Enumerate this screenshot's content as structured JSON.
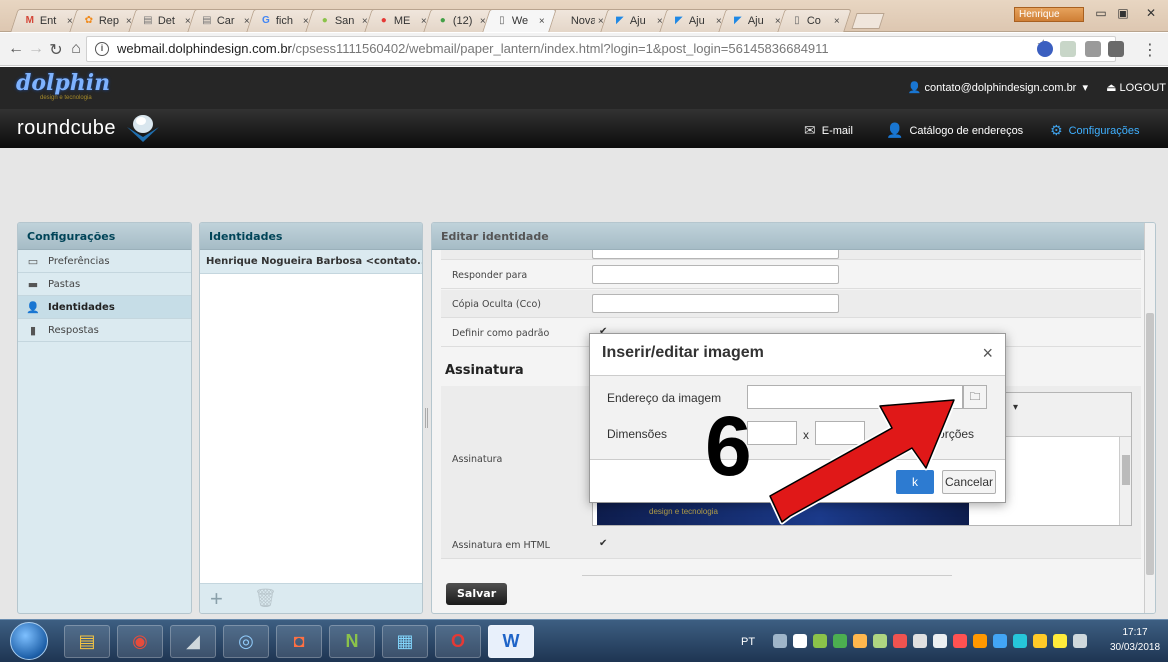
{
  "browser": {
    "tabs": [
      {
        "icon_text": "M",
        "icon_color": "#d44638",
        "title": "Ent"
      },
      {
        "icon_text": "✿",
        "icon_color": "#f08a1c",
        "title": "Rep"
      },
      {
        "icon_text": "▤",
        "icon_color": "#777777",
        "title": "Det"
      },
      {
        "icon_text": "▤",
        "icon_color": "#777777",
        "title": "Car"
      },
      {
        "icon_text": "G",
        "icon_color": "#4285f4",
        "title": "fich"
      },
      {
        "icon_text": "●",
        "icon_color": "#8bc34a",
        "title": "San"
      },
      {
        "icon_text": "●",
        "icon_color": "#e53935",
        "title": "ME"
      },
      {
        "icon_text": "●",
        "icon_color": "#43a047",
        "title": "(12)"
      },
      {
        "icon_text": "▯",
        "icon_color": "#666666",
        "title": "We"
      },
      {
        "icon_text": "",
        "icon_color": "#666666",
        "title": "Nova g"
      },
      {
        "icon_text": "◤",
        "icon_color": "#1e88e5",
        "title": "Aju"
      },
      {
        "icon_text": "◤",
        "icon_color": "#1e88e5",
        "title": "Aju"
      },
      {
        "icon_text": "◤",
        "icon_color": "#1e88e5",
        "title": "Aju"
      },
      {
        "icon_text": "▯",
        "icon_color": "#666666",
        "title": "Co"
      }
    ],
    "close_glyph": "×",
    "active_tab_index": 8,
    "window_user": "Henrique",
    "url_host": "webmail.dolphindesign.com.br",
    "url_path": "/cpsess1111560402/webmail/paper_lantern/index.html?login=1&post_login=56145836684911"
  },
  "dolphin": {
    "logo_text": "dolphin",
    "logo_sub": "design e tecnologia",
    "user_email": "contato@dolphindesign.com.br",
    "logout_label": "LOGOUT"
  },
  "roundcube": {
    "logo_text": "roundcube",
    "nav": {
      "email": "E-mail",
      "contacts": "Catálogo de endereços",
      "settings": "Configurações"
    }
  },
  "settings_panel": {
    "title": "Configurações",
    "items": [
      {
        "label": "Preferências"
      },
      {
        "label": "Pastas"
      },
      {
        "label": "Identidades"
      },
      {
        "label": "Respostas"
      }
    ],
    "selected_index": 2
  },
  "identities_panel": {
    "title": "Identidades",
    "items": [
      {
        "label": "Henrique Nogueira Barbosa <contato..."
      }
    ]
  },
  "edit_panel": {
    "title": "Editar identidade",
    "rows": {
      "reply_to": "Responder para",
      "bcc": "Cópia Oculta (Cco)",
      "default": "Definir como padrão"
    },
    "section_signature": "Assinatura",
    "signature_label": "Assinatura",
    "banner_text": "design e tecnologia",
    "html_signature_label": "Assinatura em HTML",
    "save_label": "Salvar"
  },
  "dialog": {
    "title": "Inserir/editar imagem",
    "close": "×",
    "url_label": "Endereço da imagem",
    "url_value": "",
    "dimensions_label": "Dimensões",
    "x_label": "x",
    "constrain_label": "proporções",
    "ok_label": "k",
    "cancel_label": "Cancelar"
  },
  "annotation": {
    "number": "6",
    "arrow_color": "#e01818"
  },
  "taskbar": {
    "language": "PT",
    "time": "17:17",
    "date": "30/03/2018"
  }
}
